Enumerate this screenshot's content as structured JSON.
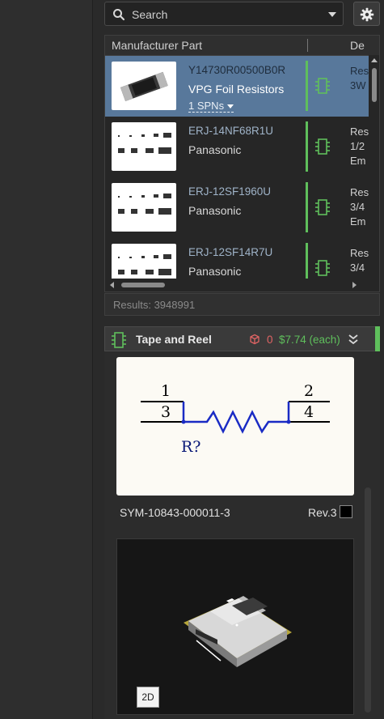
{
  "search": {
    "placeholder": "Search",
    "icon": "search-icon"
  },
  "settings": {
    "icon": "gear-icon"
  },
  "table": {
    "col_part": "Manufacturer Part",
    "col_desc": "De",
    "rows": [
      {
        "part": "Y14730R00500B0R",
        "manufacturer": "VPG Foil Resistors",
        "spn": "1 SPNs",
        "desc": "Res\n3W",
        "selected": true
      },
      {
        "part": "ERJ-14NF68R1U",
        "manufacturer": "Panasonic",
        "desc": "Res\n1/2\nEm"
      },
      {
        "part": "ERJ-12SF1960U",
        "manufacturer": "Panasonic",
        "desc": "Res\n3/4\nEm"
      },
      {
        "part": "ERJ-12SF14R7U",
        "manufacturer": "Panasonic",
        "desc": "Res\n3/4"
      }
    ]
  },
  "results": "Results: 3948991",
  "detail": {
    "title": "Tape and Reel",
    "stock": "0",
    "price": "$7.74 (each)",
    "symbol": {
      "pin1": "1",
      "pin2": "2",
      "pin3": "3",
      "pin4": "4",
      "designator": "R?"
    },
    "symbol_id": "SYM-10843-000011-3",
    "revision": "Rev.3",
    "view_toggle": "2D"
  },
  "colors": {
    "selected_row": "#58789b",
    "accent_green": "#5fbf5c",
    "stock_red": "#e06464"
  }
}
